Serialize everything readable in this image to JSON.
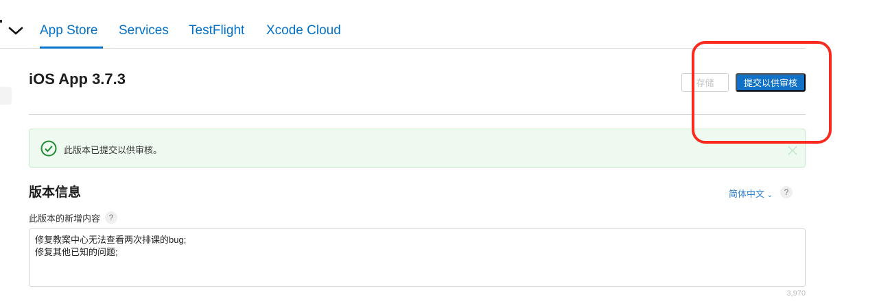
{
  "nav": {
    "tabs": [
      {
        "label": "App Store",
        "active": true
      },
      {
        "label": "Services",
        "active": false
      },
      {
        "label": "TestFlight",
        "active": false
      },
      {
        "label": "Xcode Cloud",
        "active": false
      }
    ],
    "accent_color": "#0070c9"
  },
  "page": {
    "title": "iOS App 3.7.3",
    "save_label": "存储",
    "submit_label": "提交以供审核"
  },
  "banner": {
    "message": "此版本已提交以供审核。",
    "icon": "check-circle-icon",
    "color": "#1e8a2e"
  },
  "version_info": {
    "heading": "版本信息",
    "language": "简体中文",
    "help": "?",
    "whats_new_label": "此版本的新增内容",
    "whats_new_value": "修复教案中心无法查看两次排课的bug;\n修复其他已知的问题;",
    "remaining_chars": "3,970"
  },
  "annotation": {
    "color": "#fb2a1e"
  }
}
